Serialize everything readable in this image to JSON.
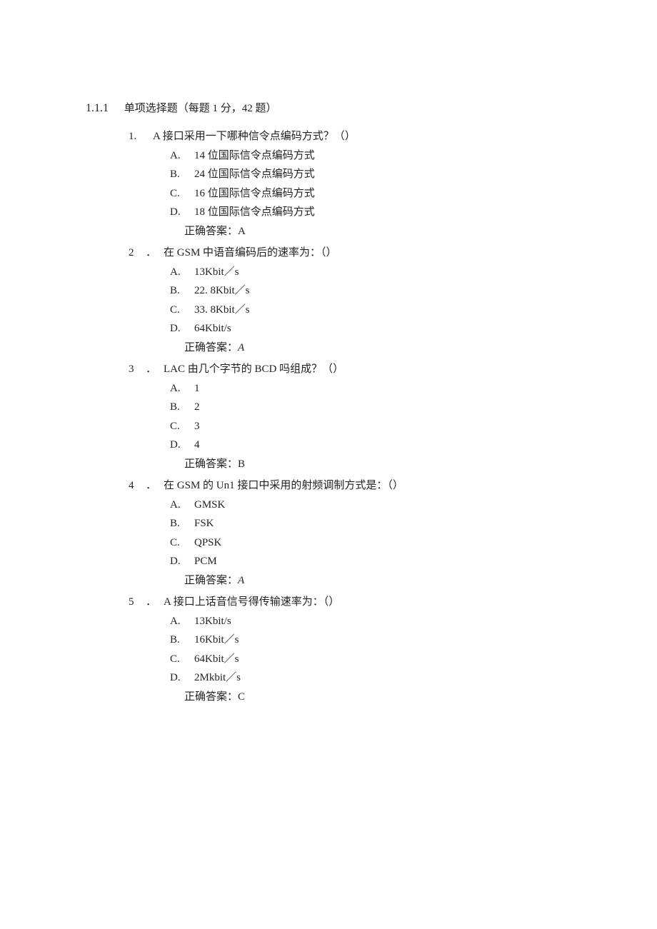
{
  "section": {
    "number": "1.1.1",
    "title": "单项选择题（每题 1 分，42 题）"
  },
  "questions": [
    {
      "num": "1.",
      "text": "A 接口采用一下哪种信令点编码方式？（）",
      "options": [
        {
          "letter": "A.",
          "text": "14 位国际信令点编码方式"
        },
        {
          "letter": "B.",
          "text": "24 位国际信令点编码方式"
        },
        {
          "letter": "C.",
          "text": "16 位国际信令点编码方式"
        },
        {
          "letter": "D.",
          "text": "18 位国际信令点编码方式"
        }
      ],
      "answer_label": "正确答案：",
      "answer_value": "A",
      "answer_italic": false
    },
    {
      "num": "2",
      "dot": "．",
      "text": "在 GSM 中语音编码后的速率为：（）",
      "options": [
        {
          "letter": "A.",
          "text": "13Kbit／s"
        },
        {
          "letter": "B.",
          "text": "22. 8Kbit／s"
        },
        {
          "letter": "C.",
          "text": "33. 8Kbit／s"
        },
        {
          "letter": "D.",
          "text": "64Kbit/s"
        }
      ],
      "answer_label": "正确答案：",
      "answer_value": "A",
      "answer_italic": true
    },
    {
      "num": "3",
      "dot": "．",
      "text": "LAC 由几个字节的 BCD 吗组成？（）",
      "options": [
        {
          "letter": "A.",
          "text": "1"
        },
        {
          "letter": "B.",
          "text": "2"
        },
        {
          "letter": "C.",
          "text": "3"
        },
        {
          "letter": "D.",
          "text": "4"
        }
      ],
      "answer_label": "正确答案：",
      "answer_value": "B",
      "answer_italic": false
    },
    {
      "num": "4",
      "dot": "．",
      "text": "在 GSM 的 Un1 接口中采用的射频调制方式是：（）",
      "options": [
        {
          "letter": "A.",
          "text": "GMSK"
        },
        {
          "letter": "B.",
          "text": "FSK"
        },
        {
          "letter": "C.",
          "text": "QPSK"
        },
        {
          "letter": "D.",
          "text": "PCM"
        }
      ],
      "answer_label": "正确答案：",
      "answer_value": "A",
      "answer_italic": true
    },
    {
      "num": "5",
      "dot": "．",
      "text": "A 接口上话音信号得传输速率为：（）",
      "options": [
        {
          "letter": "A.",
          "text": "13Kbit/s"
        },
        {
          "letter": "B.",
          "text": "16Kbit／s"
        },
        {
          "letter": "C.",
          "text": "64Kbit／s"
        },
        {
          "letter": "D.",
          "text": "2Mkbit／s"
        }
      ],
      "answer_label": "正确答案：",
      "answer_value": "C",
      "answer_italic": false
    }
  ]
}
